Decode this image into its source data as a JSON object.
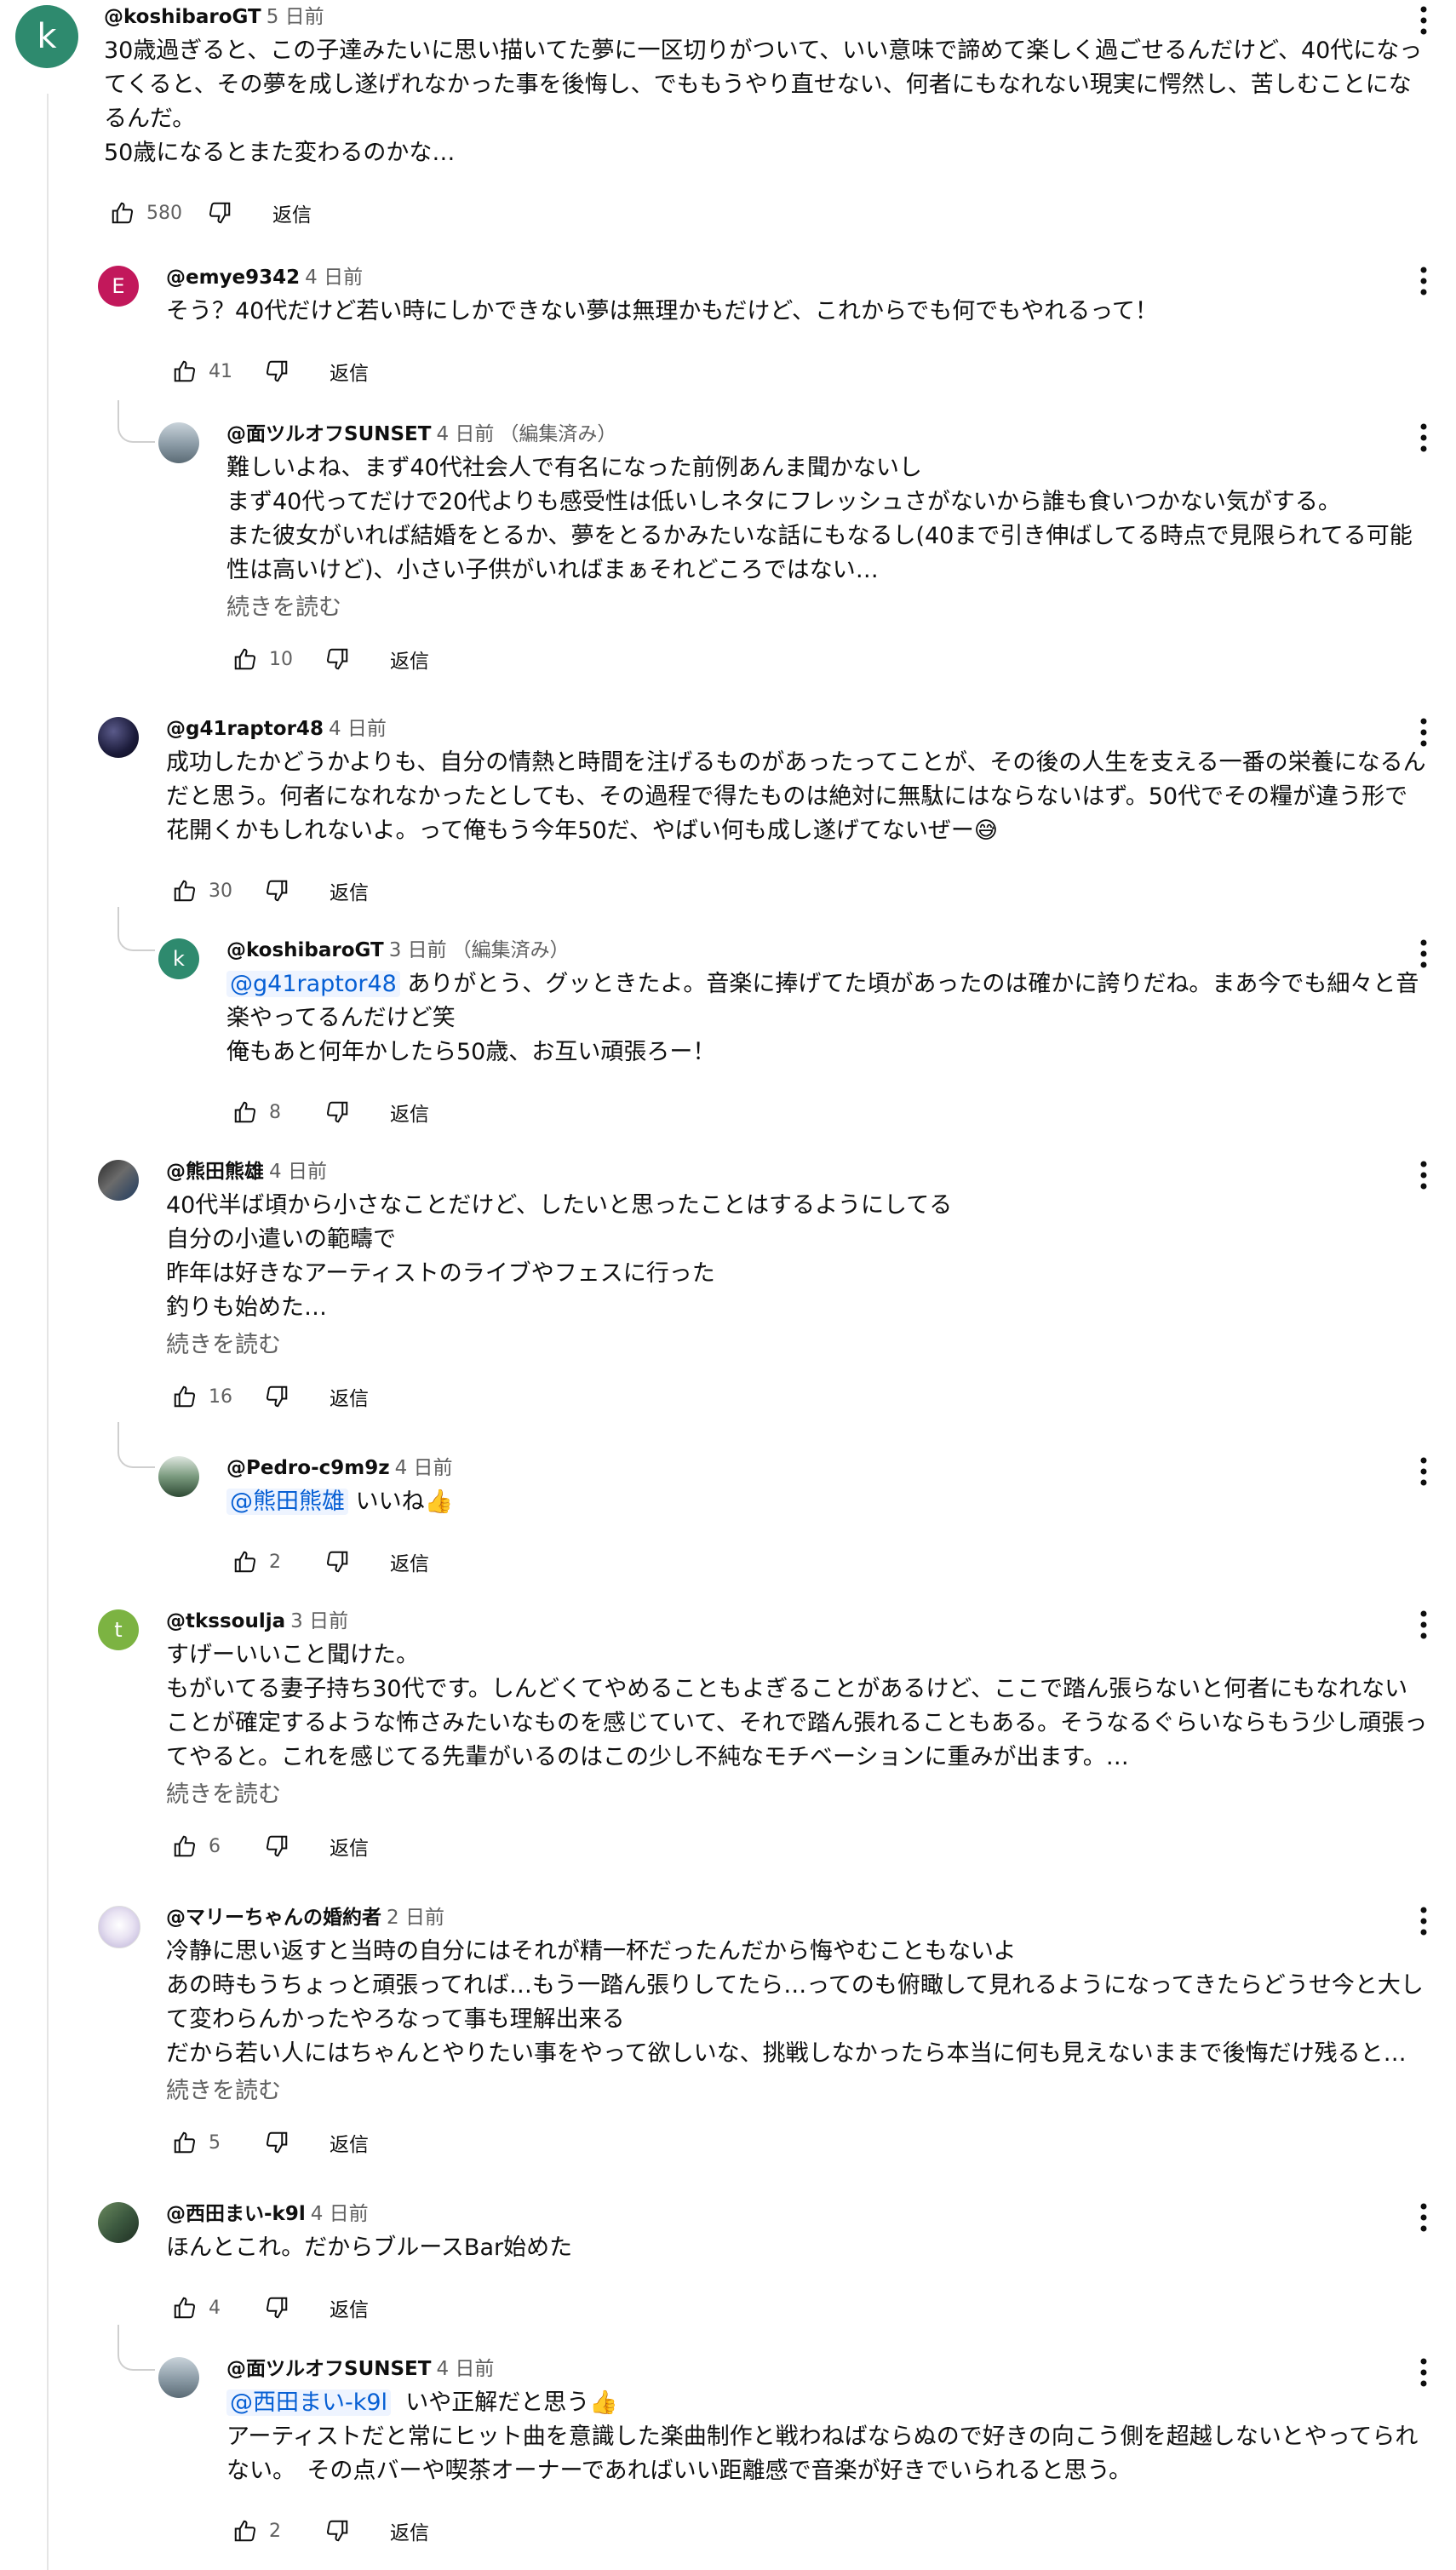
{
  "reply_label": "返信",
  "read_more_label": "続きを読む",
  "comments": [
    {
      "author": "@koshibaroGT",
      "time": "5 日前",
      "edited": "",
      "avatar_letter": "k",
      "avatar_color": "#2e8a6e",
      "text": "30歳過ぎると、この子達みたいに思い描いてた夢に一区切りがついて、いい意味で諦めて楽しく過ごせるんだけど、40代になってくると、その夢を成し遂げれなかった事を後悔し、でももうやり直せない、何者にもなれない現実に愕然し、苦しむことになるんだ。\n50歳になるとまた変わるのかな…",
      "likes": "580"
    },
    {
      "author": "@emye9342",
      "time": "4 日前",
      "edited": "",
      "avatar_letter": "E",
      "avatar_color": "#c2185b",
      "text": "そう？40代だけど若い時にしかできない夢は無理かもだけど、これからでも何でもやれるって！",
      "likes": "41"
    },
    {
      "author": "@面ツルオフSUNSET",
      "time": "4 日前",
      "edited": "（編集済み）",
      "avatar_letter": "",
      "avatar_color": "#8a9aa5",
      "text": "難しいよね、まず40代社会人で有名になった前例あんま聞かないし\nまず40代ってだけで20代よりも感受性は低いしネタにフレッシュさがないから誰も食いつかない気がする。\nまた彼女がいれば結婚をとるか、夢をとるかみたいな話にもなるし(40まで引き伸ばしてる時点で見限られてる可能性は高いけど)、小さい子供がいればまぁそれどころではない…",
      "likes": "10"
    },
    {
      "author": "@g41raptor48",
      "time": "4 日前",
      "edited": "",
      "avatar_letter": "",
      "avatar_color": "#1b1b3a",
      "text": "成功したかどうかよりも、自分の情熱と時間を注げるものがあったってことが、その後の人生を支える一番の栄養になるんだと思う。何者になれなかったとしても、その過程で得たものは絶対に無駄にはならないはず。50代でその糧が違う形で花開くかもしれないよ。って俺もう今年50だ、やばい何も成し遂げてないぜー😅",
      "likes": "30"
    },
    {
      "author": "@koshibaroGT",
      "time": "3 日前",
      "edited": "（編集済み）",
      "avatar_letter": "k",
      "avatar_color": "#2e8a6e",
      "mention": "@g41raptor48",
      "text": " ありがとう、グッときたよ。音楽に捧げてた頃があったのは確かに誇りだね。まあ今でも細々と音楽やってるんだけど笑\n俺もあと何年かしたら50歳、お互い頑張ろー！",
      "likes": "8"
    },
    {
      "author": "@熊田熊雄",
      "time": "4 日前",
      "edited": "",
      "avatar_letter": "",
      "avatar_color": "#4a4a4a",
      "text": "40代半ば頃から小さなことだけど、したいと思ったことはするようにしてる\n自分の小遣いの範疇で\n昨年は好きなアーティストのライブやフェスに行った\n釣りも始めた…",
      "likes": "16"
    },
    {
      "author": "@Pedro-c9m9z",
      "time": "4 日前",
      "edited": "",
      "avatar_letter": "",
      "avatar_color": "#4f7a5a",
      "mention": "@熊田熊雄",
      "text": " いいね👍",
      "likes": "2"
    },
    {
      "author": "@tkssoulja",
      "time": "3 日前",
      "edited": "",
      "avatar_letter": "t",
      "avatar_color": "#7cb342",
      "text": "すげーいいこと聞けた。\nもがいてる妻子持ち30代です。しんどくてやめることもよぎることがあるけど、ここで踏ん張らないと何者にもなれないことが確定するような怖さみたいなものを感じていて、それで踏ん張れることもある。そうなるぐらいならもう少し頑張ってやると。これを感じてる先輩がいるのはこの少し不純なモチベーションに重みが出ます。…",
      "likes": "6"
    },
    {
      "author": "@マリーちゃんの婚約者",
      "time": "2 日前",
      "edited": "",
      "avatar_letter": "",
      "avatar_color": "#d9d4e8",
      "text": "冷静に思い返すと当時の自分にはそれが精一杯だったんだから悔やむこともないよ\nあの時もうちょっと頑張ってれば…もう一踏ん張りしてたら…ってのも俯瞰して見れるようになってきたらどうせ今と大して変わらんかったやろなって事も理解出来る\nだから若い人にはちゃんとやりたい事をやって欲しいな、挑戦しなかったら本当に何も見えないままで後悔だけ残ると…",
      "likes": "5"
    },
    {
      "author": "@西田まい-k9l",
      "time": "4 日前",
      "edited": "",
      "avatar_letter": "",
      "avatar_color": "#3d5a40",
      "text": "ほんとこれ。だからブルースBar始めた",
      "likes": "4"
    },
    {
      "author": "@面ツルオフSUNSET",
      "time": "4 日前",
      "edited": "",
      "avatar_letter": "",
      "avatar_color": "#8a9aa5",
      "mention": "@西田まい-k9l",
      "text": "  いや正解だと思う👍\nアーティストだと常にヒット曲を意識した楽曲制作と戦わねばならぬので好きの向こう側を超越しないとやってられない。　その点バーや喫茶オーナーであればいい距離感で音楽が好きでいられると思う。",
      "likes": "2"
    }
  ]
}
